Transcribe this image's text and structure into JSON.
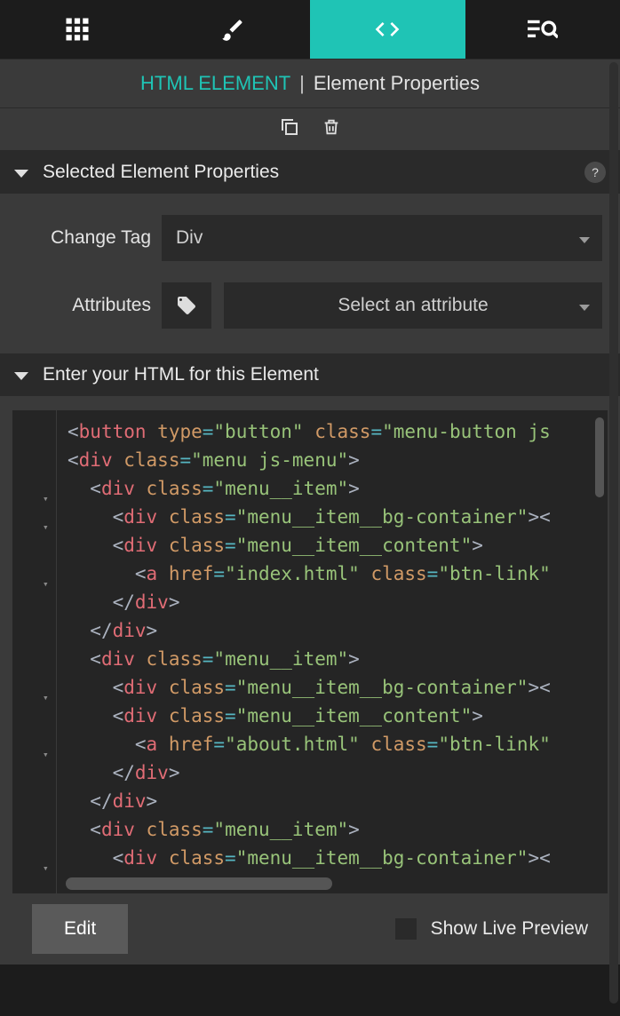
{
  "tabs": {
    "grid": "grid",
    "brush": "brush",
    "code": "code",
    "searchlist": "search"
  },
  "breadcrumb": {
    "element": "HTML ELEMENT",
    "sep": "|",
    "props": "Element Properties"
  },
  "actions": {
    "copy": "copy",
    "delete": "delete"
  },
  "section1": {
    "title": "Selected Element Properties",
    "help": "?"
  },
  "props": {
    "change_tag_label": "Change Tag",
    "change_tag_value": "Div",
    "attributes_label": "Attributes",
    "attributes_placeholder": "Select an attribute"
  },
  "section2": {
    "title": "Enter your HTML for this Element"
  },
  "code": {
    "lines": [
      {
        "indent": 0,
        "tokens": [
          [
            "punct",
            "<"
          ],
          [
            "tag",
            "button"
          ],
          [
            "space",
            " "
          ],
          [
            "attr",
            "type"
          ],
          [
            "eq",
            "="
          ],
          [
            "str",
            "\"button\""
          ],
          [
            "space",
            " "
          ],
          [
            "attr",
            "class"
          ],
          [
            "eq",
            "="
          ],
          [
            "str",
            "\"menu-button js"
          ]
        ]
      },
      {
        "indent": 0,
        "tokens": []
      },
      {
        "indent": 0,
        "fold": true,
        "tokens": [
          [
            "punct",
            "<"
          ],
          [
            "tag",
            "div"
          ],
          [
            "space",
            " "
          ],
          [
            "attr",
            "class"
          ],
          [
            "eq",
            "="
          ],
          [
            "str",
            "\"menu js-menu\""
          ],
          [
            "punct",
            ">"
          ]
        ]
      },
      {
        "indent": 1,
        "fold": true,
        "tokens": [
          [
            "punct",
            "<"
          ],
          [
            "tag",
            "div"
          ],
          [
            "space",
            " "
          ],
          [
            "attr",
            "class"
          ],
          [
            "eq",
            "="
          ],
          [
            "str",
            "\"menu__item\""
          ],
          [
            "punct",
            ">"
          ]
        ]
      },
      {
        "indent": 2,
        "tokens": [
          [
            "punct",
            "<"
          ],
          [
            "tag",
            "div"
          ],
          [
            "space",
            " "
          ],
          [
            "attr",
            "class"
          ],
          [
            "eq",
            "="
          ],
          [
            "str",
            "\"menu__item__bg-container\""
          ],
          [
            "punct",
            "><"
          ]
        ]
      },
      {
        "indent": 2,
        "fold": true,
        "tokens": [
          [
            "punct",
            "<"
          ],
          [
            "tag",
            "div"
          ],
          [
            "space",
            " "
          ],
          [
            "attr",
            "class"
          ],
          [
            "eq",
            "="
          ],
          [
            "str",
            "\"menu__item__content\""
          ],
          [
            "punct",
            ">"
          ]
        ]
      },
      {
        "indent": 3,
        "tokens": [
          [
            "punct",
            "<"
          ],
          [
            "tag",
            "a"
          ],
          [
            "space",
            " "
          ],
          [
            "attr",
            "href"
          ],
          [
            "eq",
            "="
          ],
          [
            "str",
            "\"index.html\""
          ],
          [
            "space",
            " "
          ],
          [
            "attr",
            "class"
          ],
          [
            "eq",
            "="
          ],
          [
            "str",
            "\"btn-link\""
          ]
        ]
      },
      {
        "indent": 2,
        "tokens": [
          [
            "punct",
            "</"
          ],
          [
            "tag",
            "div"
          ],
          [
            "punct",
            ">"
          ]
        ]
      },
      {
        "indent": 1,
        "tokens": [
          [
            "punct",
            "</"
          ],
          [
            "tag",
            "div"
          ],
          [
            "punct",
            ">"
          ]
        ]
      },
      {
        "indent": 1,
        "fold": true,
        "tokens": [
          [
            "punct",
            "<"
          ],
          [
            "tag",
            "div"
          ],
          [
            "space",
            " "
          ],
          [
            "attr",
            "class"
          ],
          [
            "eq",
            "="
          ],
          [
            "str",
            "\"menu__item\""
          ],
          [
            "punct",
            ">"
          ]
        ]
      },
      {
        "indent": 2,
        "tokens": [
          [
            "punct",
            "<"
          ],
          [
            "tag",
            "div"
          ],
          [
            "space",
            " "
          ],
          [
            "attr",
            "class"
          ],
          [
            "eq",
            "="
          ],
          [
            "str",
            "\"menu__item__bg-container\""
          ],
          [
            "punct",
            "><"
          ]
        ]
      },
      {
        "indent": 2,
        "fold": true,
        "tokens": [
          [
            "punct",
            "<"
          ],
          [
            "tag",
            "div"
          ],
          [
            "space",
            " "
          ],
          [
            "attr",
            "class"
          ],
          [
            "eq",
            "="
          ],
          [
            "str",
            "\"menu__item__content\""
          ],
          [
            "punct",
            ">"
          ]
        ]
      },
      {
        "indent": 3,
        "tokens": [
          [
            "punct",
            "<"
          ],
          [
            "tag",
            "a"
          ],
          [
            "space",
            " "
          ],
          [
            "attr",
            "href"
          ],
          [
            "eq",
            "="
          ],
          [
            "str",
            "\"about.html\""
          ],
          [
            "space",
            " "
          ],
          [
            "attr",
            "class"
          ],
          [
            "eq",
            "="
          ],
          [
            "str",
            "\"btn-link\""
          ]
        ]
      },
      {
        "indent": 2,
        "tokens": [
          [
            "punct",
            "</"
          ],
          [
            "tag",
            "div"
          ],
          [
            "punct",
            ">"
          ]
        ]
      },
      {
        "indent": 1,
        "tokens": [
          [
            "punct",
            "</"
          ],
          [
            "tag",
            "div"
          ],
          [
            "punct",
            ">"
          ]
        ]
      },
      {
        "indent": 1,
        "fold": true,
        "tokens": [
          [
            "punct",
            "<"
          ],
          [
            "tag",
            "div"
          ],
          [
            "space",
            " "
          ],
          [
            "attr",
            "class"
          ],
          [
            "eq",
            "="
          ],
          [
            "str",
            "\"menu__item\""
          ],
          [
            "punct",
            ">"
          ]
        ]
      },
      {
        "indent": 2,
        "tokens": [
          [
            "punct",
            "<"
          ],
          [
            "tag",
            "div"
          ],
          [
            "space",
            " "
          ],
          [
            "attr",
            "class"
          ],
          [
            "eq",
            "="
          ],
          [
            "str",
            "\"menu__item__bg-container\""
          ],
          [
            "punct",
            "><"
          ]
        ]
      }
    ]
  },
  "footer": {
    "edit": "Edit",
    "live_preview": "Show Live Preview"
  }
}
